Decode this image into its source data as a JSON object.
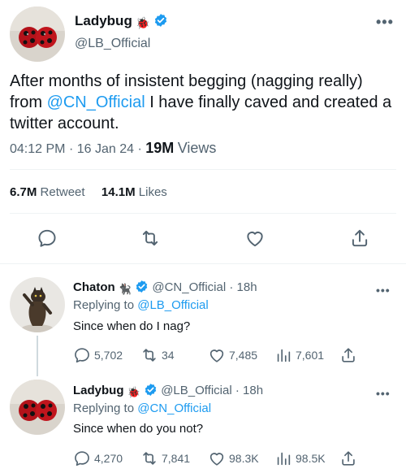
{
  "main": {
    "author_name": "Ladybug",
    "author_emoji": "🐞",
    "author_handle": "@LB_Official",
    "text_before": "After months of insistent begging (nagging really) from ",
    "mention": "@CN_Official",
    "text_after": " I have finally caved and created a twitter account.",
    "time": "04:12 PM",
    "dot": "·",
    "date": "16 Jan 24",
    "views_count": "19M",
    "views_label": "Views",
    "retweets_count": "6.7M",
    "retweets_label": "Retweet",
    "likes_count": "14.1M",
    "likes_label": "Likes",
    "more": "•••"
  },
  "replies": [
    {
      "name": "Chaton",
      "emoji": "🐈‍⬛",
      "handle": "@CN_Official",
      "dot": "·",
      "age": "18h",
      "replying_label": "Replying to",
      "replying_to": "@LB_Official",
      "text": "Since when do I nag?",
      "replies": "5,702",
      "retweets": "34",
      "likes": "7,485",
      "views": "7,601",
      "more": "•••"
    },
    {
      "name": "Ladybug",
      "emoji": "🐞",
      "handle": "@LB_Official",
      "dot": "·",
      "age": "18h",
      "replying_label": "Replying to",
      "replying_to": "@CN_Official",
      "text": "Since when do you not?",
      "replies": "4,270",
      "retweets": "7,841",
      "likes": "98.3K",
      "views": "98.5K",
      "more": "•••"
    }
  ],
  "colors": {
    "accent": "#1d9bf0",
    "text": "#0f1419",
    "muted": "#536471",
    "divider": "#eff3f4"
  }
}
